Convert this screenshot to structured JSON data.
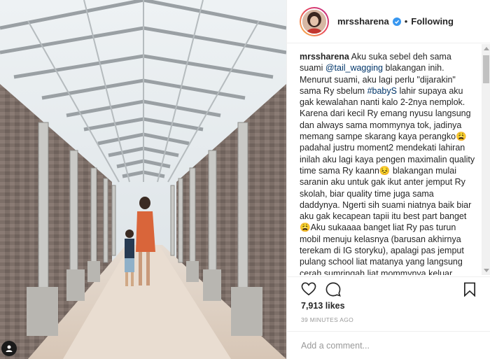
{
  "post": {
    "username": "mrssharena",
    "follow_status": "Following",
    "separator": "•",
    "caption_username": "mrssharena",
    "caption_parts": [
      " Aku suka sebel deh sama suami ",
      "@tail_wagging",
      " blakangan inih. Menurut suami, aku lagi perlu \"dijarakin\" sama Ry sbelum ",
      "#babyS",
      " lahir supaya aku gak kewalahan nanti kalo 2-2nya nemplok. Karena dari kecil Ry emang nyusu langsung dan always sama mommynya tok, jadinya memang sampe skarang kaya perangko😩 padahal justru moment2 mendekati lahiran inilah aku lagi kaya pengen maximalin quality time sama Ry kaann😣 blakangan mulai saranin aku untuk gak ikut anter jemput Ry skolah, biar quality time juga sama daddynya. Ngerti sih suami niatnya baik biar aku gak kecapean tapii itu best part banget😩Aku sukaaaa banget liat Ry pas turun mobil menuju kelasnya (barusan akhirnya terekam di IG storyku), apalagi pas jemput pulang school liat matanya yang langsung cerah sumringah liat mommynya keluar. Karena dulu juga pernah ngalamin."
    ],
    "likes": "7,913 likes",
    "time_ago": "39 MINUTES AGO",
    "comment_placeholder": "Add a comment..."
  },
  "icons": {
    "verified": "verified-badge-icon",
    "like": "heart-icon",
    "comment": "comment-bubble-icon",
    "save": "bookmark-icon",
    "tagged_user": "person-icon"
  },
  "colors": {
    "verified": "#3897f0",
    "link": "#003569",
    "muted": "#999999",
    "text": "#262626"
  }
}
